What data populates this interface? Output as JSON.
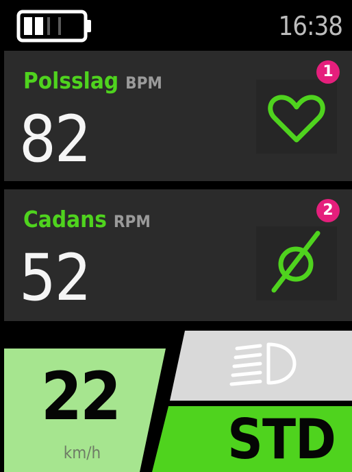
{
  "status": {
    "battery_level": 0.5,
    "time": "16:38"
  },
  "metrics": [
    {
      "name": "Polsslag",
      "unit": "BPM",
      "value": "82",
      "icon": "heart-icon",
      "badge": "1"
    },
    {
      "name": "Cadans",
      "unit": "RPM",
      "value": "52",
      "icon": "cadence-icon",
      "badge": "2"
    }
  ],
  "speed": {
    "value": "22",
    "unit": "km/h"
  },
  "light": {
    "icon": "headlight-icon",
    "state": "off"
  },
  "assist_mode": {
    "label": "STD"
  },
  "colors": {
    "accent_green": "#4fd31e",
    "speed_green": "#a6e58f",
    "badge_magenta": "#e51f7c",
    "panel_bg": "#2b2b2b",
    "light_panel": "#d9d9d9"
  }
}
